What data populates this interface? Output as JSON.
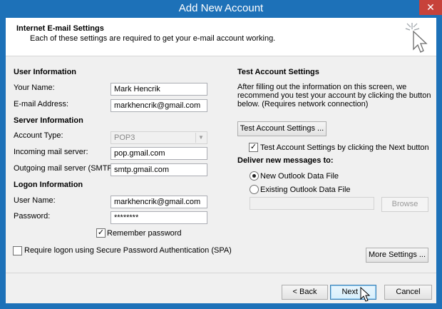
{
  "window": {
    "title": "Add New Account",
    "close_glyph": "✕"
  },
  "header": {
    "title": "Internet E-mail Settings",
    "subtitle": "Each of these settings are required to get your e-mail account working."
  },
  "user_info": {
    "section": "User Information",
    "name_label": "Your Name:",
    "name_value": "Mark Hencrik",
    "email_label": "E-mail Address:",
    "email_value": "markhencrik@gmail.com"
  },
  "server_info": {
    "section": "Server Information",
    "account_type_label": "Account Type:",
    "account_type_value": "POP3",
    "incoming_label": "Incoming mail server:",
    "incoming_value": "pop.gmail.com",
    "outgoing_label": "Outgoing mail server (SMTP):",
    "outgoing_value": "smtp.gmail.com"
  },
  "logon_info": {
    "section": "Logon Information",
    "user_label": "User Name:",
    "user_value": "markhencrik@gmail.com",
    "password_label": "Password:",
    "password_value": "********",
    "remember_label": "Remember password",
    "spa_label": "Require logon using Secure Password Authentication (SPA)"
  },
  "test": {
    "section": "Test Account Settings",
    "description": [
      "After filling out the information on this screen, we",
      "recommend you test your account by clicking the button",
      "below. (Requires network connection)"
    ],
    "button": "Test Account Settings ...",
    "auto_test_label": "Test Account Settings by clicking the Next button"
  },
  "deliver": {
    "section": "Deliver new messages to:",
    "new_label": "New Outlook Data File",
    "existing_label": "Existing Outlook Data File",
    "browse": "Browse"
  },
  "more_settings": "More Settings ...",
  "footer": {
    "back": "< Back",
    "next": "Next >",
    "cancel": "Cancel"
  },
  "colors": {
    "titlebar": "#1d71b8",
    "close": "#c7423a",
    "dialog_bg": "#f0f0f0"
  },
  "icons": {
    "header": "sparkle-cursor-icon",
    "mouse": "mouse-pointer-icon",
    "check": "checkmark-icon"
  }
}
